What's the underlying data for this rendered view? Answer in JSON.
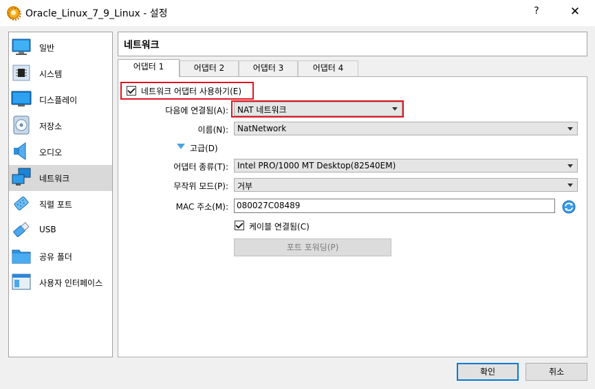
{
  "window": {
    "title": "Oracle_Linux_7_9_Linux - 설정",
    "help_label": "?",
    "close_label": "✕"
  },
  "sidebar": {
    "items": [
      {
        "label": "일반",
        "icon": "general-icon"
      },
      {
        "label": "시스템",
        "icon": "system-chip-icon"
      },
      {
        "label": "디스플레이",
        "icon": "display-icon"
      },
      {
        "label": "저장소",
        "icon": "storage-disk-icon"
      },
      {
        "label": "오디오",
        "icon": "audio-speaker-icon"
      },
      {
        "label": "네트워크",
        "icon": "network-icon",
        "selected": true
      },
      {
        "label": "직렬 포트",
        "icon": "serial-port-icon"
      },
      {
        "label": "USB",
        "icon": "usb-icon"
      },
      {
        "label": "공유 폴더",
        "icon": "shared-folder-icon"
      },
      {
        "label": "사용자 인터페이스",
        "icon": "user-interface-icon"
      }
    ]
  },
  "page": {
    "title": "네트워크"
  },
  "tabs": [
    {
      "label": "어댑터 1",
      "active": true
    },
    {
      "label": "어댑터 2"
    },
    {
      "label": "어댑터 3"
    },
    {
      "label": "어댑터 4"
    }
  ],
  "adapter": {
    "enable_label": "네트워크 어댑터 사용하기(E)",
    "enable_checked": true,
    "attached_label": "다음에 연결됨(A):",
    "attached_value": "NAT 네트워크",
    "name_label": "이름(N):",
    "name_value": "NatNetwork",
    "advanced_label": "고급(D)",
    "type_label": "어댑터 종류(T):",
    "type_value": "Intel PRO/1000 MT Desktop(82540EM)",
    "promisc_label": "무작위 모드(P):",
    "promisc_value": "거부",
    "mac_label": "MAC 주소(M):",
    "mac_value": "080027C08489",
    "cable_label": "케이블 연결됨(C)",
    "cable_checked": true,
    "port_forwarding_label": "포트 포워딩(P)"
  },
  "footer": {
    "ok_label": "확인",
    "cancel_label": "취소"
  },
  "colors": {
    "highlight_red": "#e0141e",
    "selection_gray": "#d9d9d9",
    "accent_blue": "#0078d7"
  }
}
